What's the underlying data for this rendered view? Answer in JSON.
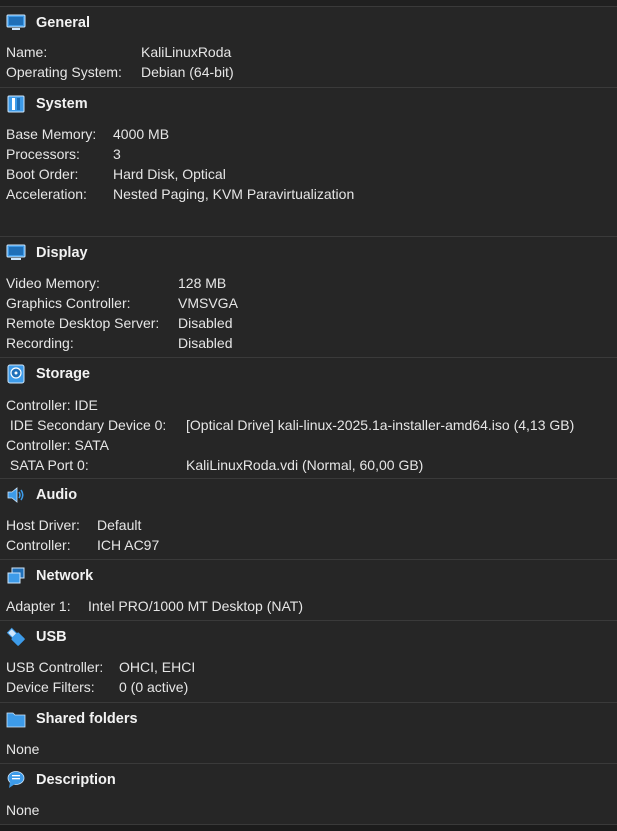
{
  "sections": {
    "general": {
      "title": "General",
      "icon": "monitor-icon",
      "rows": [
        {
          "label": "Name:",
          "value": "KaliLinuxRoda"
        },
        {
          "label": "Operating System:",
          "value": "Debian (64-bit)"
        }
      ]
    },
    "system": {
      "title": "System",
      "icon": "chip-icon",
      "rows": [
        {
          "label": "Base Memory:",
          "value": "4000 MB"
        },
        {
          "label": "Processors:",
          "value": "3"
        },
        {
          "label": "Boot Order:",
          "value": "Hard Disk, Optical"
        },
        {
          "label": "Acceleration:",
          "value": "Nested Paging, KVM Paravirtualization"
        }
      ]
    },
    "display": {
      "title": "Display",
      "icon": "display-icon",
      "rows": [
        {
          "label": "Video Memory:",
          "value": "128 MB"
        },
        {
          "label": "Graphics Controller:",
          "value": "VMSVGA"
        },
        {
          "label": "Remote Desktop Server:",
          "value": "Disabled"
        },
        {
          "label": "Recording:",
          "value": "Disabled"
        }
      ]
    },
    "storage": {
      "title": "Storage",
      "icon": "storage-icon",
      "rows": [
        {
          "label": "Controller: IDE",
          "value": ""
        },
        {
          "label": " IDE Secondary Device 0:",
          "value": "[Optical Drive] kali-linux-2025.1a-installer-amd64.iso (4,13 GB)"
        },
        {
          "label": "Controller: SATA",
          "value": ""
        },
        {
          "label": " SATA Port 0:",
          "value": "KaliLinuxRoda.vdi (Normal, 60,00 GB)"
        }
      ]
    },
    "audio": {
      "title": "Audio",
      "icon": "speaker-icon",
      "rows": [
        {
          "label": "Host Driver:",
          "value": "Default"
        },
        {
          "label": "Controller:",
          "value": "ICH AC97"
        }
      ]
    },
    "network": {
      "title": "Network",
      "icon": "network-icon",
      "rows": [
        {
          "label": "Adapter 1:",
          "value": "Intel PRO/1000 MT Desktop (NAT)"
        }
      ]
    },
    "usb": {
      "title": "USB",
      "icon": "usb-icon",
      "rows": [
        {
          "label": "USB Controller:",
          "value": "OHCI, EHCI"
        },
        {
          "label": "Device Filters:",
          "value": "0 (0 active)"
        }
      ]
    },
    "shared": {
      "title": "Shared folders",
      "icon": "folder-icon",
      "rows": [
        {
          "label": "None",
          "value": ""
        }
      ]
    },
    "description": {
      "title": "Description",
      "icon": "speech-bubble-icon",
      "rows": [
        {
          "label": "None",
          "value": ""
        }
      ]
    }
  },
  "colors": {
    "background": "#262626",
    "text": "#e6e6e6",
    "accent": "#3d9be9"
  }
}
